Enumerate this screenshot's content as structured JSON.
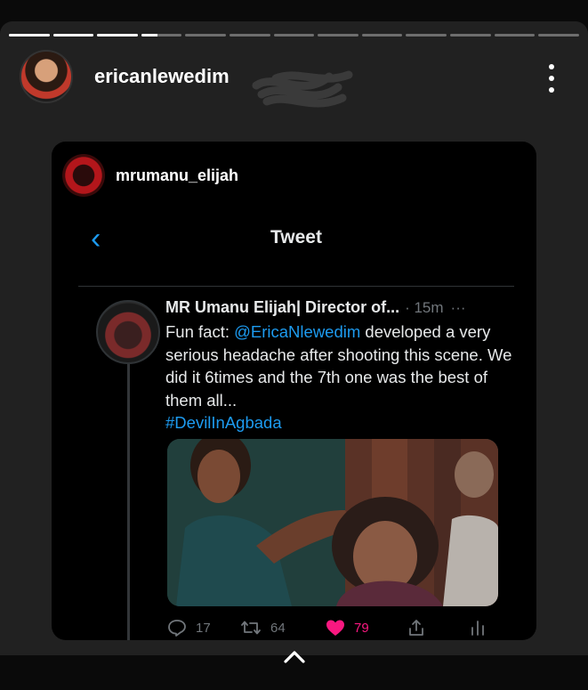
{
  "story": {
    "username": "ericanlewedim",
    "segments_total": 13,
    "segments_complete": 3,
    "current_segment_progress": 0.4
  },
  "reshare": {
    "username": "mrumanu_elijah"
  },
  "tweet_view": {
    "title": "Tweet",
    "author": "MR Umanu Elijah| Director of...",
    "time": "· 15m",
    "more": "···",
    "text_prefix": "Fun fact: ",
    "mention": "@EricaNlewedim",
    "text_rest": " developed a very serious headache after shooting this scene. We did it 6times and the 7th one was the best of them all...",
    "hashtag": "#DevilInAgbada",
    "replies": "17",
    "retweets": "64",
    "likes": "79"
  },
  "colors": {
    "link": "#1d9bf0",
    "like": "#f91880",
    "muted": "#71767b"
  }
}
